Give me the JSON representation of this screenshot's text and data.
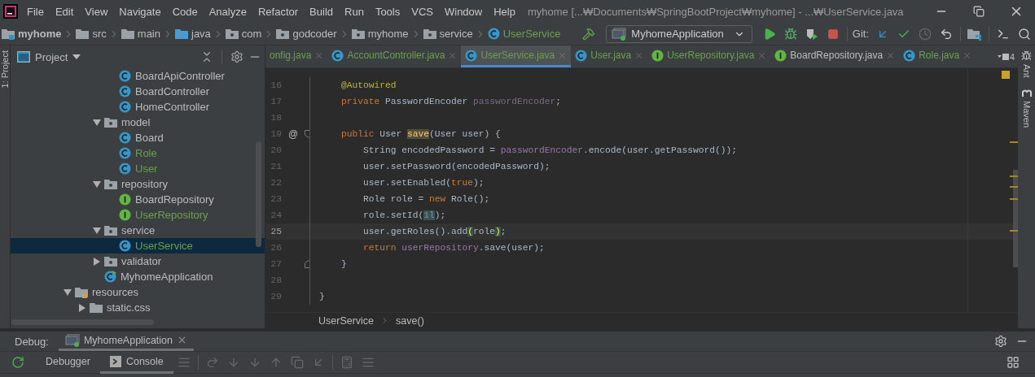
{
  "menu_bar": {
    "items": [
      "File",
      "Edit",
      "View",
      "Navigate",
      "Code",
      "Analyze",
      "Refactor",
      "Build",
      "Run",
      "Tools",
      "VCS",
      "Window",
      "Help"
    ],
    "title": "myhome [...₩Documents₩SpringBootProject₩myhome] - ...₩UserService.java"
  },
  "navigation_bar": {
    "crumbs": [
      {
        "label": "myhome",
        "kind": "module"
      },
      {
        "label": "src",
        "kind": "folder"
      },
      {
        "label": "main",
        "kind": "folder"
      },
      {
        "label": "java",
        "kind": "source"
      },
      {
        "label": "com",
        "kind": "package"
      },
      {
        "label": "godcoder",
        "kind": "package"
      },
      {
        "label": "myhome",
        "kind": "package"
      },
      {
        "label": "service",
        "kind": "package"
      },
      {
        "label": "UserService",
        "kind": "class"
      }
    ],
    "run_config": "MyhomeApplication",
    "git_label": "Git:"
  },
  "side_stripes": {
    "left": "1: Project",
    "right": [
      "Ant",
      "Maven"
    ]
  },
  "project_panel": {
    "title": "Project",
    "tree": [
      {
        "children": [
          {
            "children": [
              {
                "children": [
                  {
                    "label": "BoardApiController",
                    "kind": "class",
                    "added": false,
                    "selected": false
                  },
                  {
                    "label": "BoardController",
                    "kind": "class",
                    "added": false,
                    "selected": false
                  },
                  {
                    "label": "HomeController",
                    "kind": "class",
                    "added": false,
                    "selected": false
                  }
                ]
              },
              {
                "label": "model",
                "kind": "package",
                "expanded": true,
                "added": false,
                "selected": false,
                "children": [
                  {
                    "label": "Board",
                    "kind": "class",
                    "added": false,
                    "selected": false
                  },
                  {
                    "label": "Role",
                    "kind": "class",
                    "added": true,
                    "selected": false
                  },
                  {
                    "label": "User",
                    "kind": "class",
                    "added": true,
                    "selected": false
                  }
                ]
              },
              {
                "label": "repository",
                "kind": "package",
                "expanded": true,
                "added": false,
                "selected": false,
                "children": [
                  {
                    "label": "BoardRepository",
                    "kind": "interface",
                    "added": false,
                    "selected": false
                  },
                  {
                    "label": "UserRepository",
                    "kind": "interface",
                    "added": true,
                    "selected": false
                  }
                ]
              },
              {
                "label": "service",
                "kind": "package",
                "expanded": true,
                "added": false,
                "selected": false,
                "children": [
                  {
                    "label": "UserService",
                    "kind": "class",
                    "added": true,
                    "selected": true
                  }
                ]
              },
              {
                "label": "validator",
                "kind": "package",
                "expanded": false,
                "added": false,
                "selected": false
              },
              {
                "label": "MyhomeApplication",
                "kind": "app",
                "added": false,
                "selected": false
              }
            ]
          }
        ]
      },
      {
        "label": "resources",
        "kind": "resources",
        "expanded": true,
        "added": false,
        "selected": false,
        "children": [
          {
            "label": "static.css",
            "kind": "folder",
            "expanded": false,
            "added": false,
            "selected": false
          }
        ]
      }
    ]
  },
  "editor": {
    "tabs": [
      {
        "label": "onfig.java",
        "kind": "cut",
        "added": true,
        "selected": false
      },
      {
        "label": "AccountController.java",
        "kind": "class",
        "added": true,
        "selected": false
      },
      {
        "label": "UserService.java",
        "kind": "class",
        "added": true,
        "selected": true
      },
      {
        "label": "User.java",
        "kind": "class",
        "added": true,
        "selected": false
      },
      {
        "label": "UserRepository.java",
        "kind": "interface",
        "added": true,
        "selected": false
      },
      {
        "label": "BoardRepository.java",
        "kind": "interface",
        "added": false,
        "selected": false
      },
      {
        "label": "Role.java",
        "kind": "class",
        "added": true,
        "selected": false
      }
    ],
    "hidden_tab_count": "4",
    "lines": [
      {
        "number": "16",
        "kind": "plain",
        "current": false,
        "segments": [
          {
            "kind": "annotation",
            "text": "    @Autowired"
          }
        ]
      },
      {
        "number": "17",
        "kind": "plain",
        "current": false,
        "segments": [
          {
            "kind": "keyword",
            "text": "    private "
          },
          {
            "kind": "plain",
            "text": "PasswordEncoder "
          },
          {
            "kind": "unused",
            "text": "passwordEncoder"
          },
          {
            "kind": "plain",
            "text": ";"
          }
        ]
      },
      {
        "number": "18",
        "kind": "plain",
        "current": false
      },
      {
        "number": "19",
        "kind": "fold-start",
        "current": false,
        "gutter": "@",
        "segments": [
          {
            "kind": "keyword",
            "text": "    public "
          },
          {
            "kind": "plain",
            "text": "User "
          },
          {
            "kind": "declaration",
            "text": "save"
          },
          {
            "kind": "plain",
            "text": "(User user) {"
          }
        ]
      },
      {
        "number": "20",
        "kind": "plain",
        "current": false,
        "segments": [
          {
            "kind": "plain",
            "text": "        String encodedPassword = "
          },
          {
            "kind": "field",
            "text": "passwordEncoder"
          },
          {
            "kind": "plain",
            "text": ".encode(user.getPassword());"
          }
        ]
      },
      {
        "number": "21",
        "kind": "plain",
        "current": false,
        "segments": [
          {
            "kind": "plain",
            "text": "        user.setPassword(encodedPassword);"
          }
        ]
      },
      {
        "number": "22",
        "kind": "plain",
        "current": false,
        "segments": [
          {
            "kind": "plain",
            "text": "        user.setEnabled("
          },
          {
            "kind": "keyword",
            "text": "true"
          },
          {
            "kind": "plain",
            "text": ");"
          }
        ]
      },
      {
        "number": "23",
        "kind": "plain",
        "current": false,
        "segments": [
          {
            "kind": "plain",
            "text": "        Role role = "
          },
          {
            "kind": "keyword",
            "text": "new "
          },
          {
            "kind": "plain",
            "text": "Role();"
          }
        ]
      },
      {
        "number": "24",
        "kind": "plain",
        "current": false,
        "segments": [
          {
            "kind": "plain",
            "text": "        role.setId("
          },
          {
            "kind": "number-match",
            "text": "1l"
          },
          {
            "kind": "plain",
            "text": ");"
          }
        ]
      },
      {
        "number": "25",
        "kind": "plain",
        "current": true,
        "segments": [
          {
            "kind": "plain",
            "text": "        user.getRoles().add"
          },
          {
            "kind": "brace-match",
            "text": "("
          },
          {
            "kind": "plain",
            "text": "role"
          },
          {
            "kind": "brace-match",
            "text": ")"
          },
          {
            "kind": "plain",
            "text": ";"
          }
        ]
      },
      {
        "number": "26",
        "kind": "plain",
        "current": false,
        "segments": [
          {
            "kind": "keyword",
            "text": "        return "
          },
          {
            "kind": "field",
            "text": "userRepository"
          },
          {
            "kind": "plain",
            "text": ".save(user);"
          }
        ]
      },
      {
        "number": "27",
        "kind": "fold-end",
        "current": false,
        "segments": [
          {
            "kind": "plain",
            "text": "    }"
          }
        ]
      },
      {
        "number": "28",
        "kind": "plain",
        "current": false
      },
      {
        "number": "29",
        "kind": "plain",
        "current": false,
        "segments": [
          {
            "kind": "plain",
            "text": "}"
          }
        ]
      }
    ],
    "breadcrumbs": [
      "UserService",
      "save()"
    ]
  },
  "debug_panel": {
    "label": "Debug:",
    "session": "MyhomeApplication",
    "tabs": [
      {
        "label": "Debugger",
        "selected": false
      },
      {
        "label": "Console",
        "selected": true
      }
    ]
  }
}
